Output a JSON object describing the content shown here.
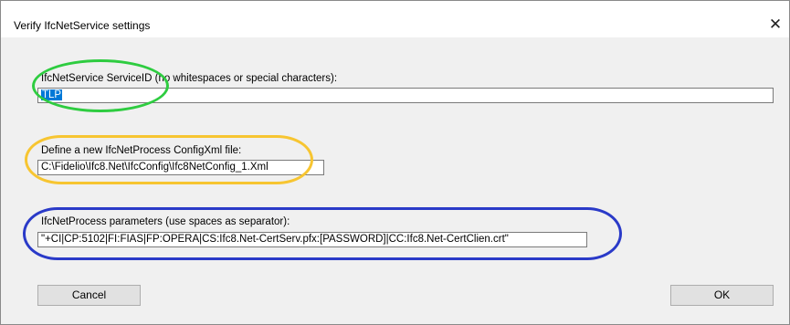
{
  "window": {
    "title": "Verify IfcNetService settings",
    "close_label": "✕"
  },
  "service_id": {
    "label": "IfcNetService ServiceID (no whitespaces or special characters):",
    "value": "TLP"
  },
  "config_xml": {
    "label": "Define a new IfcNetProcess ConfigXml file:",
    "value": "C:\\Fidelio\\Ifc8.Net\\IfcConfig\\Ifc8NetConfig_1.Xml"
  },
  "process_params": {
    "label": "IfcNetProcess parameters (use spaces as separator):",
    "value": "\"+CI|CP:5102|FI:FIAS|FP:OPERA|CS:Ifc8.Net-CertServ.pfx:[PASSWORD]|CC:Ifc8.Net-CertClien.crt\""
  },
  "buttons": {
    "cancel": "Cancel",
    "ok": "OK"
  },
  "highlight_colors": {
    "green": "#2ecc40",
    "yellow": "#f7c531",
    "blue": "#2a3ac8"
  }
}
